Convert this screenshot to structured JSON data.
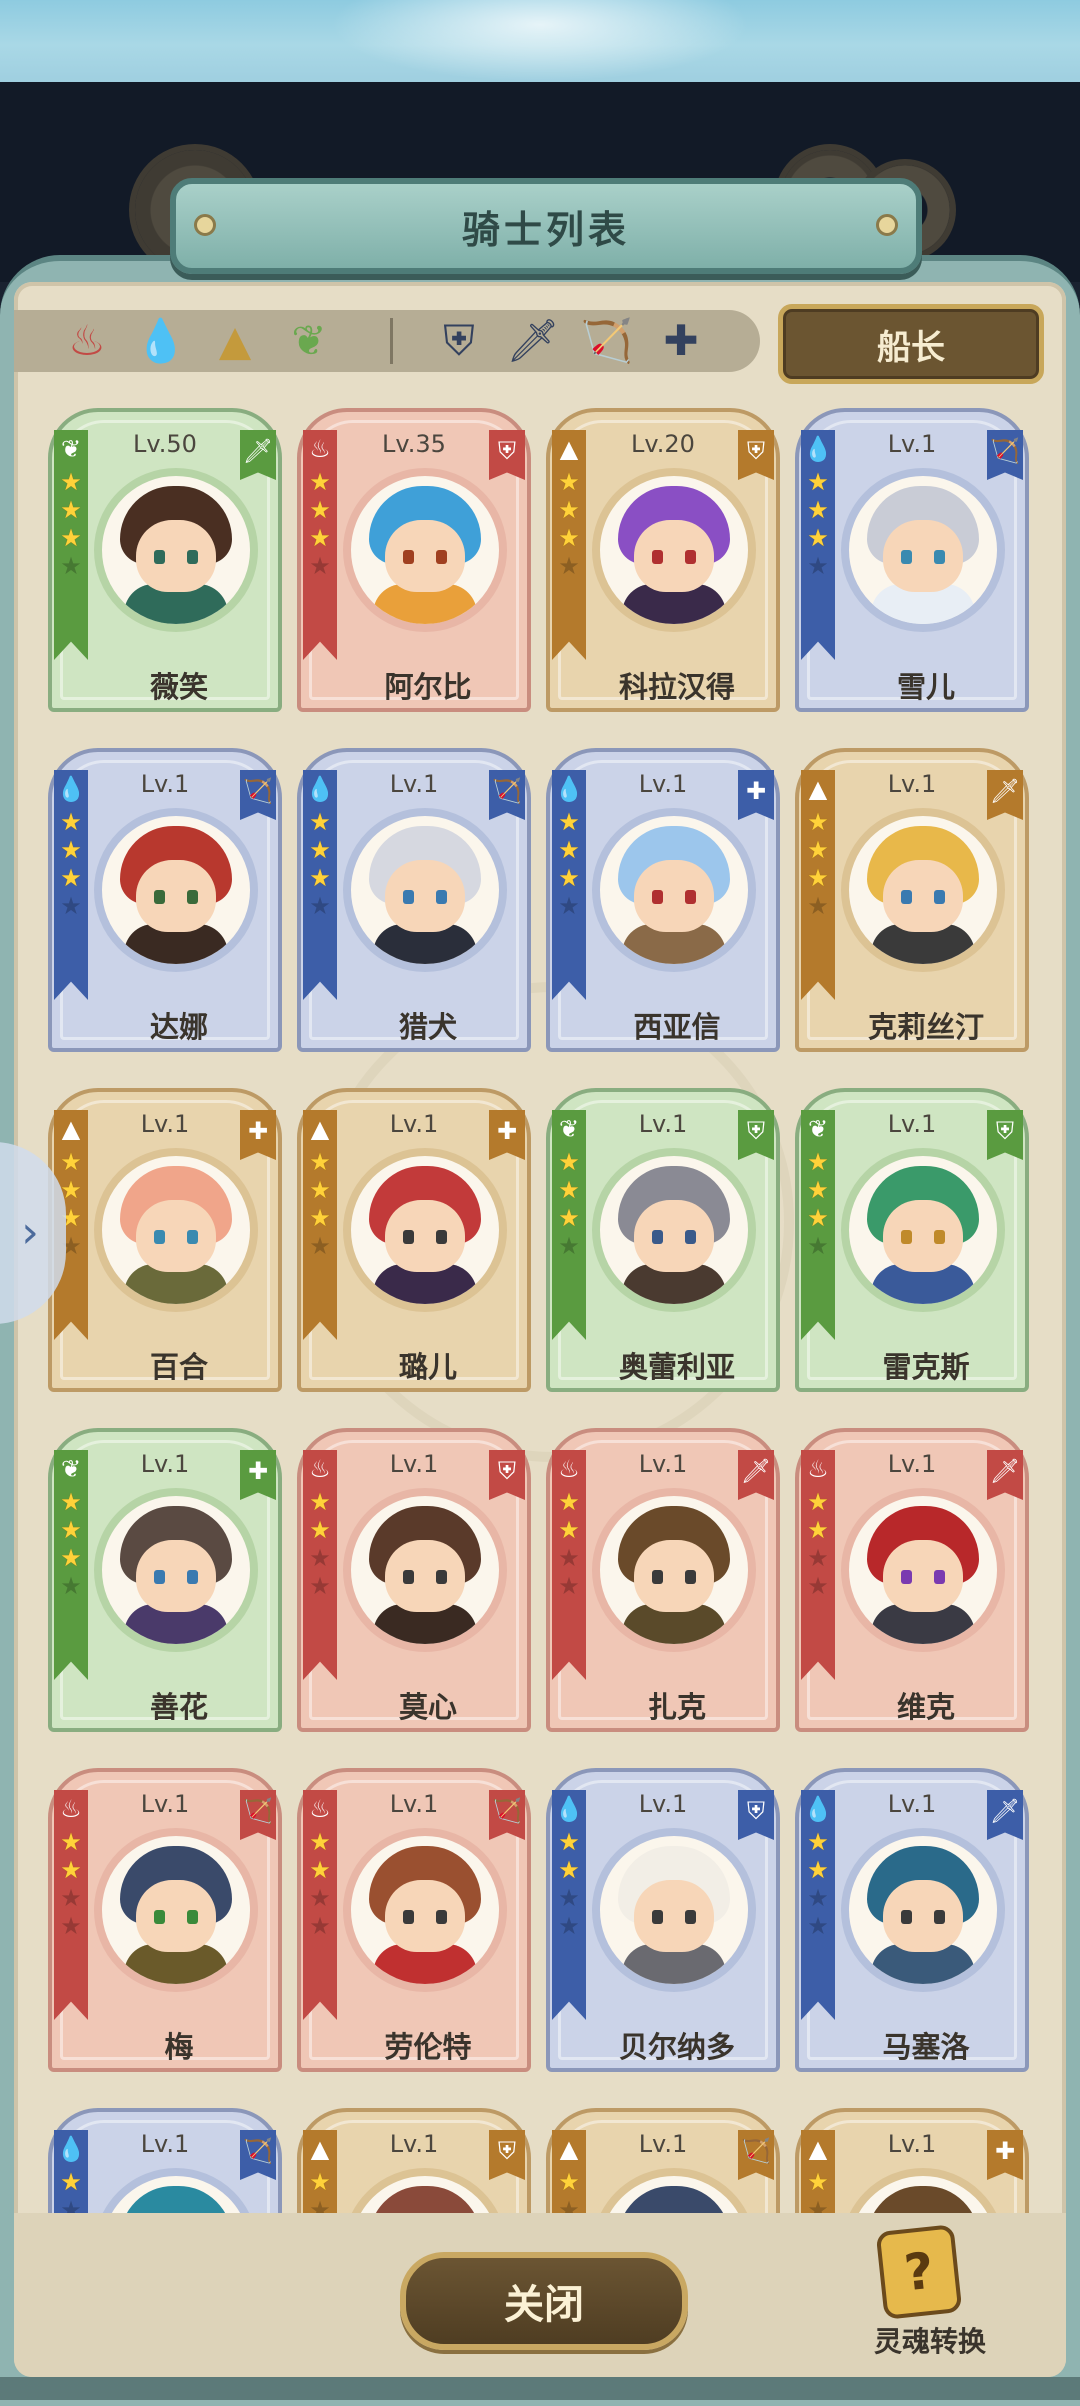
{
  "title": "骑士列表",
  "filters": {
    "elements": [
      {
        "name": "fire-filter-icon",
        "glyph": "♨",
        "color": "#c24a45"
      },
      {
        "name": "water-filter-icon",
        "glyph": "💧",
        "color": "#3d6fc0"
      },
      {
        "name": "earth-filter-icon",
        "glyph": "▲",
        "color": "#c49a3c"
      },
      {
        "name": "wind-filter-icon",
        "glyph": "❦",
        "color": "#6aa84f"
      }
    ],
    "classes": [
      {
        "name": "shield-filter-icon",
        "glyph": "⛨",
        "color": "#33415e"
      },
      {
        "name": "sword-filter-icon",
        "glyph": "🗡",
        "color": "#33415e"
      },
      {
        "name": "bow-filter-icon",
        "glyph": "🏹",
        "color": "#33415e"
      },
      {
        "name": "healer-cross-filter-icon",
        "glyph": "✚",
        "color": "#33415e"
      }
    ],
    "captain_label": "船长"
  },
  "knights": [
    {
      "name": "薇笑",
      "level": "Lv.50",
      "element": "wind",
      "class": "sword",
      "stars": 3,
      "hair": "#4a2f22",
      "outfit": "#2f6b5a",
      "eye": "#2f6b5a"
    },
    {
      "name": "阿尔比",
      "level": "Lv.35",
      "element": "fire",
      "class": "shield",
      "stars": 3,
      "hair": "#3fa0d8",
      "outfit": "#e9a03a",
      "eye": "#a04020"
    },
    {
      "name": "科拉汉得",
      "level": "Lv.20",
      "element": "earth",
      "class": "shield",
      "stars": 3,
      "hair": "#8a4fc4",
      "outfit": "#3a2a4a",
      "eye": "#b03030"
    },
    {
      "name": "雪儿",
      "level": "Lv.1",
      "element": "water",
      "class": "bow",
      "stars": 3,
      "hair": "#c9ccd6",
      "outfit": "#e8eef5",
      "eye": "#3a8ab0"
    },
    {
      "name": "达娜",
      "level": "Lv.1",
      "element": "water",
      "class": "bow",
      "stars": 3,
      "hair": "#b8382e",
      "outfit": "#3a2a22",
      "eye": "#3a6a3a"
    },
    {
      "name": "猎犬",
      "level": "Lv.1",
      "element": "water",
      "class": "bow",
      "stars": 3,
      "hair": "#d6d8e0",
      "outfit": "#2a2e3a",
      "eye": "#3a7ab0"
    },
    {
      "name": "西亚信",
      "level": "Lv.1",
      "element": "water",
      "class": "healer",
      "stars": 3,
      "hair": "#9cc6ec",
      "outfit": "#8a6a48",
      "eye": "#b03030"
    },
    {
      "name": "克莉丝汀",
      "level": "Lv.1",
      "element": "earth",
      "class": "sword",
      "stars": 3,
      "hair": "#e8b84a",
      "outfit": "#3a3a3a",
      "eye": "#3a7ab0"
    },
    {
      "name": "百合",
      "level": "Lv.1",
      "element": "earth",
      "class": "healer",
      "stars": 3,
      "hair": "#f0a58a",
      "outfit": "#6a6a3a",
      "eye": "#3a8ab0"
    },
    {
      "name": "璐儿",
      "level": "Lv.1",
      "element": "earth",
      "class": "healer",
      "stars": 3,
      "hair": "#c23a3a",
      "outfit": "#3a2a4a",
      "eye": "#3a3a3a"
    },
    {
      "name": "奥蕾利亚",
      "level": "Lv.1",
      "element": "wind",
      "class": "shield",
      "stars": 3,
      "hair": "#8a8a94",
      "outfit": "#4a3a30",
      "eye": "#3a5a8a"
    },
    {
      "name": "雷克斯",
      "level": "Lv.1",
      "element": "wind",
      "class": "shield",
      "stars": 3,
      "hair": "#3a9a6a",
      "outfit": "#3a5a9a",
      "eye": "#c08a2a"
    },
    {
      "name": "善花",
      "level": "Lv.1",
      "element": "wind",
      "class": "healer",
      "stars": 3,
      "hair": "#5a4a42",
      "outfit": "#4a3a6a",
      "eye": "#3a7ab0"
    },
    {
      "name": "莫心",
      "level": "Lv.1",
      "element": "fire",
      "class": "shield",
      "stars": 2,
      "hair": "#5a3a2a",
      "outfit": "#3a2a22",
      "eye": "#3a3a3a"
    },
    {
      "name": "扎克",
      "level": "Lv.1",
      "element": "fire",
      "class": "sword",
      "stars": 2,
      "hair": "#6a4a2a",
      "outfit": "#5a4a2a",
      "eye": "#3a3a3a"
    },
    {
      "name": "维克",
      "level": "Lv.1",
      "element": "fire",
      "class": "sword",
      "stars": 2,
      "hair": "#b8282a",
      "outfit": "#3a3a44",
      "eye": "#7a3ab0"
    },
    {
      "name": "梅",
      "level": "Lv.1",
      "element": "fire",
      "class": "bow",
      "stars": 2,
      "hair": "#3a4a6a",
      "outfit": "#6a5a2a",
      "eye": "#3a8a3a"
    },
    {
      "name": "劳伦特",
      "level": "Lv.1",
      "element": "fire",
      "class": "bow",
      "stars": 2,
      "hair": "#9a5030",
      "outfit": "#c03030",
      "eye": "#3a3a3a"
    },
    {
      "name": "贝尔纳多",
      "level": "Lv.1",
      "element": "water",
      "class": "shield",
      "stars": 2,
      "hair": "#f2eee6",
      "outfit": "#6a6a70",
      "eye": "#3a3a3a"
    },
    {
      "name": "马塞洛",
      "level": "Lv.1",
      "element": "water",
      "class": "sword",
      "stars": 2,
      "hair": "#2a6a8a",
      "outfit": "#3a5a7a",
      "eye": "#3a3a3a"
    },
    {
      "name": "",
      "level": "Lv.1",
      "element": "water",
      "class": "bow",
      "stars": 1,
      "hair": "#2a8aa0",
      "outfit": "#3a5a7a",
      "eye": "#3a3a3a"
    },
    {
      "name": "",
      "level": "Lv.1",
      "element": "earth",
      "class": "shield",
      "stars": 1,
      "hair": "#8a4a3a",
      "outfit": "#5a4a3a",
      "eye": "#3a3a3a"
    },
    {
      "name": "",
      "level": "Lv.1",
      "element": "earth",
      "class": "bow",
      "stars": 1,
      "hair": "#3a4a6a",
      "outfit": "#5a4a3a",
      "eye": "#3a3a3a"
    },
    {
      "name": "",
      "level": "Lv.1",
      "element": "earth",
      "class": "healer",
      "stars": 1,
      "hair": "#6a4a2a",
      "outfit": "#5a4a3a",
      "eye": "#3a3a3a"
    }
  ],
  "close_label": "关闭",
  "soul_convert_label": "灵魂转换",
  "soul_icon_glyph": "?",
  "side_tab_glyph": "›",
  "glyphs": {
    "element": {
      "fire": "♨",
      "water": "💧",
      "earth": "▲",
      "wind": "❦"
    },
    "class": {
      "shield": "⛨",
      "sword": "🗡",
      "bow": "🏹",
      "healer": "✚"
    }
  }
}
